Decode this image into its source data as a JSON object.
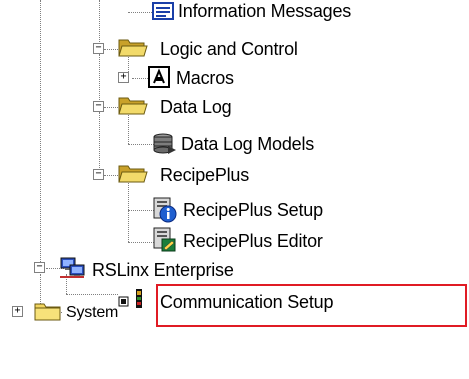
{
  "tree": {
    "items": [
      {
        "label": "Information Messages",
        "icon": "information-messages-icon",
        "expander": ""
      },
      {
        "label": "Logic and Control",
        "icon": "folder-open-icon",
        "expander": "−"
      },
      {
        "label": "Macros",
        "icon": "macros-icon",
        "expander": "+"
      },
      {
        "label": "Data Log",
        "icon": "folder-open-icon",
        "expander": "−"
      },
      {
        "label": "Data Log Models",
        "icon": "database-icon",
        "expander": ""
      },
      {
        "label": "RecipePlus",
        "icon": "folder-open-icon",
        "expander": "−"
      },
      {
        "label": "RecipePlus Setup",
        "icon": "recipe-setup-icon",
        "expander": ""
      },
      {
        "label": "RecipePlus Editor",
        "icon": "recipe-editor-icon",
        "expander": ""
      },
      {
        "label": "RSLinx Enterprise",
        "icon": "network-computer-icon",
        "expander": "−"
      },
      {
        "label": "Communication Setup",
        "icon": "communication-icon",
        "expander": ""
      },
      {
        "label": "System",
        "icon": "folder-closed-icon",
        "expander": "+"
      }
    ]
  },
  "colors": {
    "highlight": "#e01b24",
    "folder": "#e8c64a",
    "connector": "#808080"
  }
}
